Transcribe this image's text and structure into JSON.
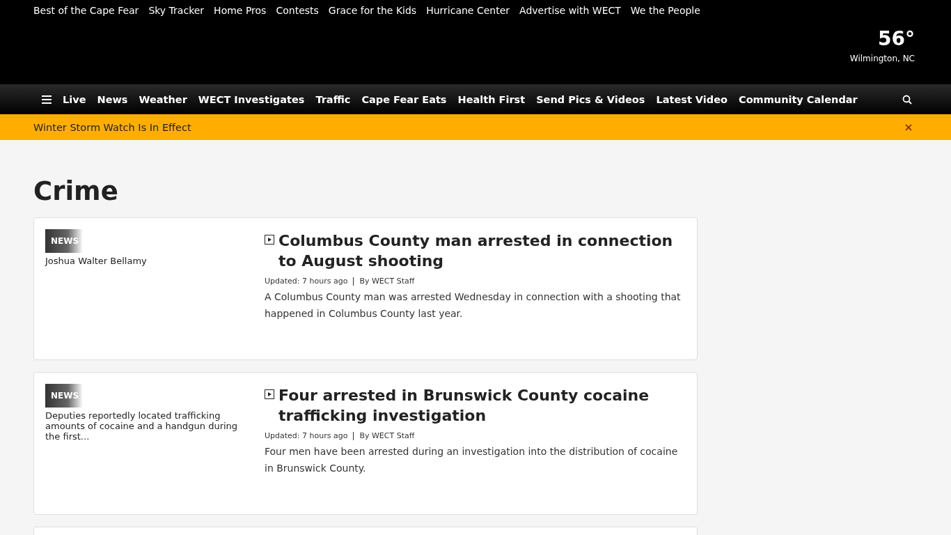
{
  "top_links": [
    "Best of the Cape Fear",
    "Sky Tracker",
    "Home Pros",
    "Contests",
    "Grace for the Kids",
    "Hurricane Center",
    "Advertise with WECT",
    "We the People"
  ],
  "weather": {
    "temperature": "56°",
    "location": "Wilmington, NC"
  },
  "nav": {
    "items": [
      "Live",
      "News",
      "Weather",
      "WECT Investigates",
      "Traffic",
      "Cape Fear Eats",
      "Health First",
      "Send Pics & Videos",
      "Latest Video",
      "Community Calendar"
    ]
  },
  "alert": {
    "text": "Winter Storm Watch Is In Effect"
  },
  "page_title": "Crime",
  "stories": [
    {
      "image_alt": "Joshua Walter Bellamy",
      "badge": "NEWS",
      "headline": "Columbus County man arrested in connection to August shooting",
      "updated": "Updated: 7 hours ago",
      "byline": "By WECT Staff",
      "summary": "A Columbus County man was arrested Wednesday in connection with a shooting that happened in Columbus County last year."
    },
    {
      "image_alt": "Deputies reportedly located trafficking amounts of cocaine and a handgun during the first...",
      "badge": "NEWS",
      "headline": "Four arrested in Brunswick County cocaine trafficking investigation",
      "updated": "Updated: 7 hours ago",
      "byline": "By WECT Staff",
      "summary": "Four men have been arrested during an investigation into the distribution of cocaine in Brunswick County."
    }
  ]
}
